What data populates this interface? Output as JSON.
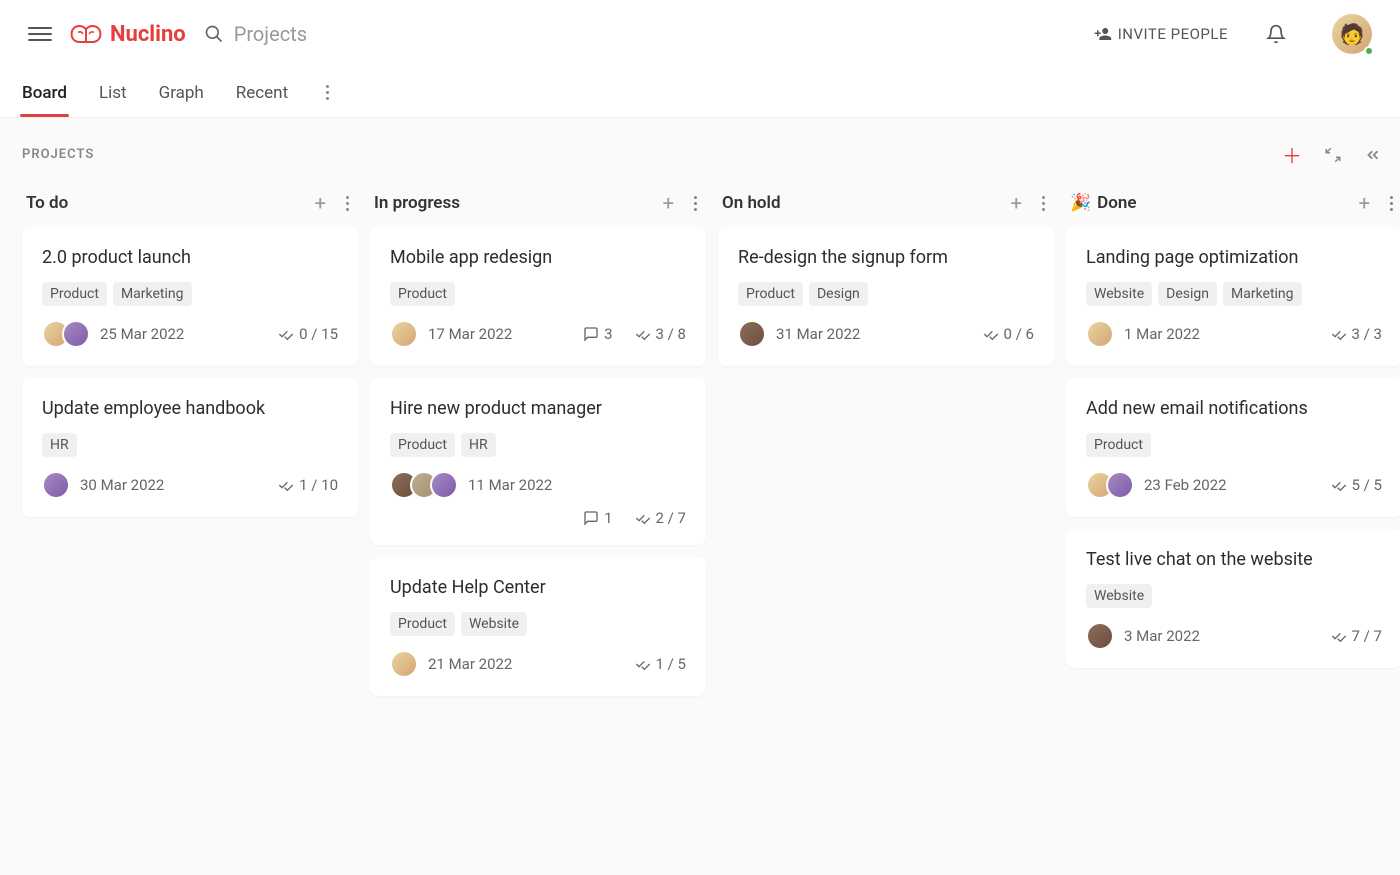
{
  "header": {
    "logo_text": "Nuclino",
    "search_placeholder": "Projects",
    "invite_label": "INVITE PEOPLE"
  },
  "tabs": [
    {
      "label": "Board",
      "active": true
    },
    {
      "label": "List",
      "active": false
    },
    {
      "label": "Graph",
      "active": false
    },
    {
      "label": "Recent",
      "active": false
    }
  ],
  "section": {
    "title": "PROJECTS"
  },
  "columns": [
    {
      "title": "To do",
      "emoji": "",
      "cards": [
        {
          "title": "2.0 product launch",
          "tags": [
            "Product",
            "Marketing"
          ],
          "avatars": [
            "av1",
            "av2"
          ],
          "date": "25 Mar 2022",
          "comments": null,
          "checklist": "0 / 15",
          "extra": false
        },
        {
          "title": "Update employee handbook",
          "tags": [
            "HR"
          ],
          "avatars": [
            "av2"
          ],
          "date": "30 Mar 2022",
          "comments": null,
          "checklist": "1 / 10",
          "extra": false
        }
      ]
    },
    {
      "title": "In progress",
      "emoji": "",
      "cards": [
        {
          "title": "Mobile app redesign",
          "tags": [
            "Product"
          ],
          "avatars": [
            "av1"
          ],
          "date": "17 Mar 2022",
          "comments": "3",
          "checklist": "3 / 8",
          "extra": false
        },
        {
          "title": "Hire new product manager",
          "tags": [
            "Product",
            "HR"
          ],
          "avatars": [
            "av3",
            "av4",
            "av2"
          ],
          "date": "11 Mar 2022",
          "comments": "1",
          "checklist": "2 / 7",
          "extra": true
        },
        {
          "title": "Update Help Center",
          "tags": [
            "Product",
            "Website"
          ],
          "avatars": [
            "av1"
          ],
          "date": "21 Mar 2022",
          "comments": null,
          "checklist": "1 / 5",
          "extra": false
        }
      ]
    },
    {
      "title": "On hold",
      "emoji": "",
      "cards": [
        {
          "title": "Re-design the signup form",
          "tags": [
            "Product",
            "Design"
          ],
          "avatars": [
            "av3"
          ],
          "date": "31 Mar 2022",
          "comments": null,
          "checklist": "0 / 6",
          "extra": false
        }
      ]
    },
    {
      "title": "Done",
      "emoji": "🎉",
      "cards": [
        {
          "title": "Landing page optimization",
          "tags": [
            "Website",
            "Design",
            "Marketing"
          ],
          "avatars": [
            "av1"
          ],
          "date": "1 Mar 2022",
          "comments": null,
          "checklist": "3 / 3",
          "extra": false
        },
        {
          "title": "Add new email notifications",
          "tags": [
            "Product"
          ],
          "avatars": [
            "av1",
            "av2"
          ],
          "date": "23 Feb 2022",
          "comments": null,
          "checklist": "5 / 5",
          "extra": false
        },
        {
          "title": "Test live chat on the website",
          "tags": [
            "Website"
          ],
          "avatars": [
            "av3"
          ],
          "date": "3 Mar 2022",
          "comments": null,
          "checklist": "7 / 7",
          "extra": false
        }
      ]
    }
  ]
}
